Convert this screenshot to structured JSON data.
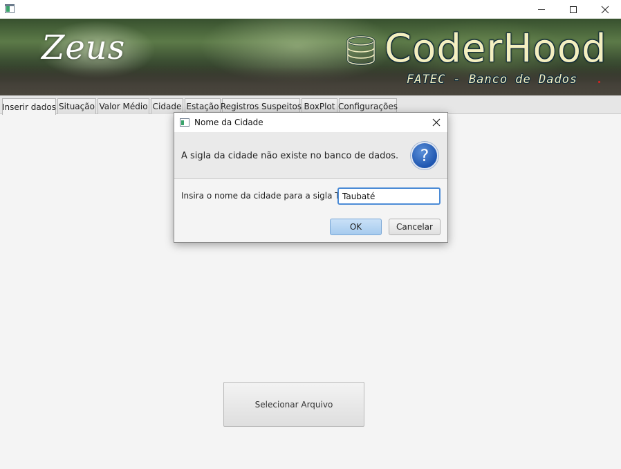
{
  "window": {
    "icon": "app-icon",
    "controls": [
      "minimize-icon",
      "maximize-icon",
      "close-icon"
    ]
  },
  "banner": {
    "left_text": "Zeus",
    "brand": "CoderHood",
    "subtitle": "FATEC - Banco de Dados",
    "brand_color": "#f4efc0"
  },
  "tabs": [
    {
      "label": "Inserir dados",
      "active": true
    },
    {
      "label": "Situação",
      "active": false
    },
    {
      "label": "Valor Médio",
      "active": false
    },
    {
      "label": "Cidade",
      "active": false
    },
    {
      "label": "Estação",
      "active": false
    },
    {
      "label": "Registros Suspeitos",
      "active": false
    },
    {
      "label": "BoxPlot",
      "active": false
    },
    {
      "label": "Configurações",
      "active": false
    }
  ],
  "main": {
    "select_file_label": "Selecionar Arquivo"
  },
  "dialog": {
    "title": "Nome da Cidade",
    "message": "A sigla da cidade não existe no banco de dados.",
    "icon": "question-icon",
    "field_label": "Insira o nome da cidade para a sigla TBT:",
    "field_value": "Taubaté",
    "ok_label": "OK",
    "cancel_label": "Cancelar",
    "accent_color": "#4b8bd6"
  }
}
